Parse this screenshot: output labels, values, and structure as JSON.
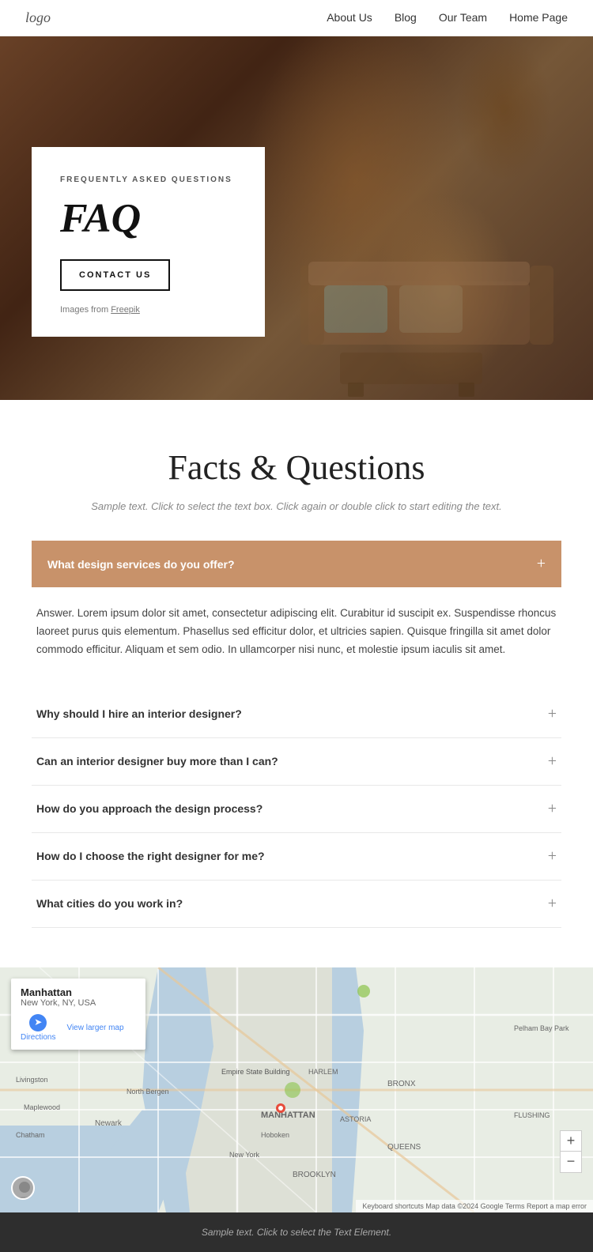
{
  "navbar": {
    "logo": "logo",
    "links": [
      {
        "label": "About Us",
        "href": "#"
      },
      {
        "label": "Blog",
        "href": "#"
      },
      {
        "label": "Our Team",
        "href": "#"
      },
      {
        "label": "Home Page",
        "href": "#"
      }
    ]
  },
  "hero": {
    "subtitle": "FREQUENTLY ASKED QUESTIONS",
    "title": "FAQ",
    "button_label": "CONTACT US",
    "images_text": "Images from ",
    "images_link": "Freepik"
  },
  "faq_section": {
    "main_title": "Facts & Questions",
    "subtitle": "Sample text. Click to select the text box. Click again or double click to start editing the text.",
    "active_question": "What design services do you offer?",
    "active_answer": "Answer. Lorem ipsum dolor sit amet, consectetur adipiscing elit. Curabitur id suscipit ex. Suspendisse rhoncus laoreet purus quis elementum. Phasellus sed efficitur dolor, et ultricies sapien. Quisque fringilla sit amet dolor commodo efficitur. Aliquam et sem odio. In ullamcorper nisi nunc, et molestie ipsum iaculis sit amet.",
    "questions": [
      {
        "label": "Why should I hire an interior designer?"
      },
      {
        "label": "Can an interior designer buy more than I can?"
      },
      {
        "label": "How do you approach the design process?"
      },
      {
        "label": "How do I choose the right designer for me?"
      },
      {
        "label": "What cities do you work in?"
      }
    ]
  },
  "map": {
    "popup_title": "Manhattan",
    "popup_address": "New York, NY, USA",
    "popup_directions": "Directions",
    "popup_link": "View larger map",
    "bottom_bar": "Keyboard shortcuts  Map data ©2024 Google  Terms  Report a map error",
    "zoom_in": "+",
    "zoom_out": "−"
  },
  "footer": {
    "text": "Sample text. Click to select the Text Element."
  }
}
